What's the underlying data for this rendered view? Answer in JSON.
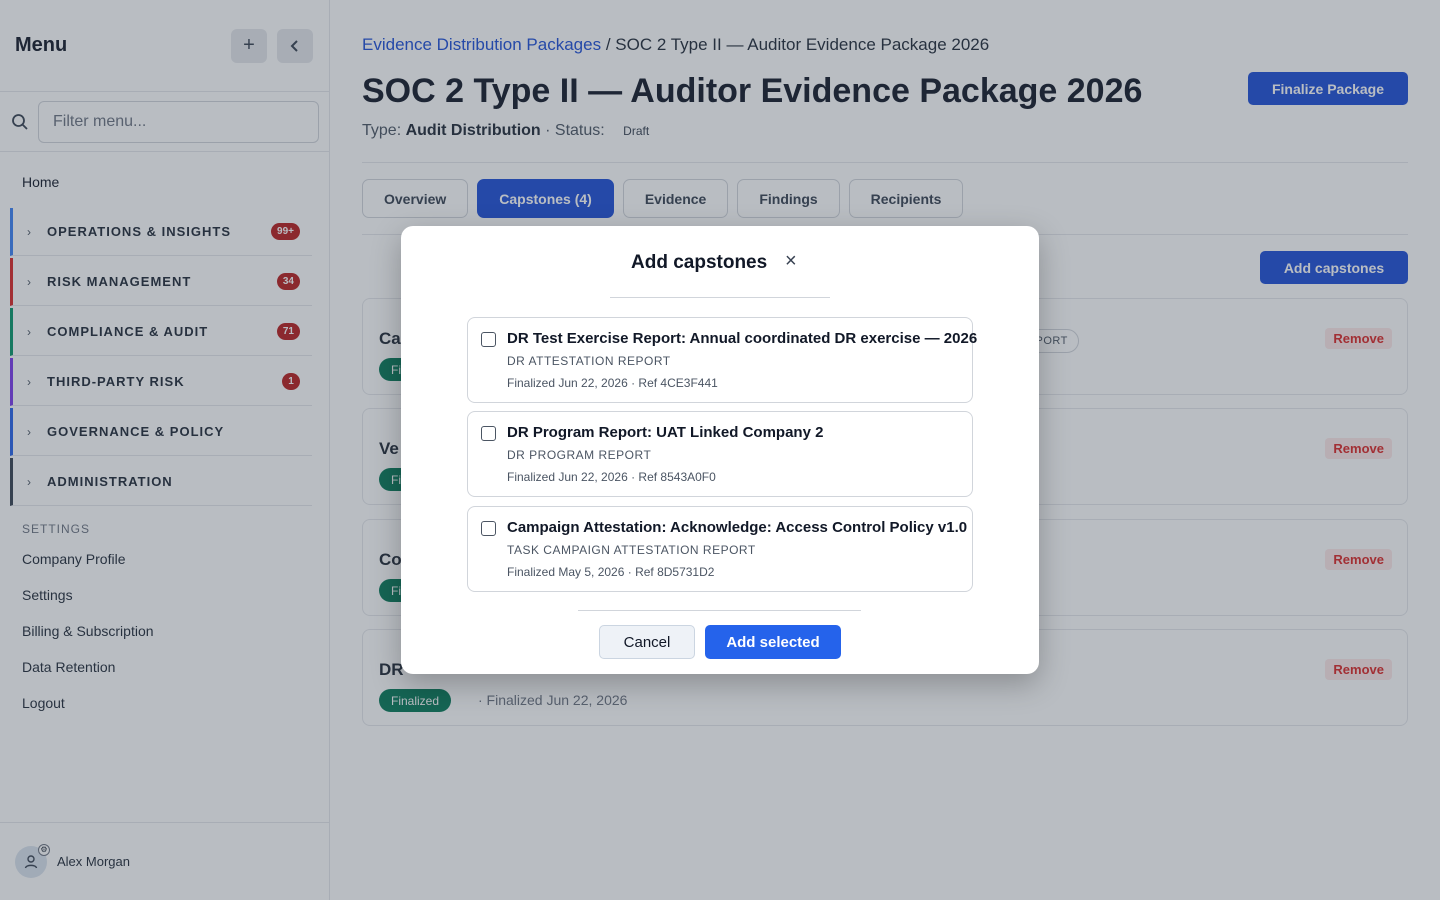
{
  "sidebar": {
    "title": "Menu",
    "add_icon": "plus-icon",
    "collapse_icon": "chevron-left-icon",
    "search_placeholder": "Filter menu...",
    "home": "Home",
    "groups": [
      {
        "label": "OPERATIONS & INSIGHTS",
        "badge": "99+",
        "color": "#3b82f6"
      },
      {
        "label": "RISK MANAGEMENT",
        "badge": "34",
        "color": "#dc2626"
      },
      {
        "label": "COMPLIANCE & AUDIT",
        "badge": "71",
        "color": "#059669"
      },
      {
        "label": "THIRD-PARTY RISK",
        "badge": "1",
        "color": "#7c3aed"
      },
      {
        "label": "GOVERNANCE & POLICY",
        "badge": "",
        "color": "#2563eb"
      },
      {
        "label": "ADMINISTRATION",
        "badge": "",
        "color": "#374151"
      }
    ],
    "settings_heading": "SETTINGS",
    "links": [
      "Company Profile",
      "Settings",
      "Billing & Subscription",
      "Data Retention",
      "Logout"
    ],
    "user": "Alex Morgan"
  },
  "main": {
    "breadcrumb_link": "Evidence Distribution Packages",
    "breadcrumb_sep": "/",
    "breadcrumb_current": "SOC 2 Type II — Auditor Evidence Package 2026",
    "title": "SOC 2 Type II — Auditor Evidence Package 2026",
    "type_label": "Type:",
    "type_value": "Audit Distribution",
    "status_label": "· Status:",
    "status_value": "Draft",
    "finalize_label": "Finalize Package",
    "tabs": [
      "Overview",
      "Capstones (4)",
      "Evidence",
      "Findings",
      "Recipients"
    ],
    "active_tab": 1,
    "add_capstones_label": "Add capstones",
    "cards": [
      {
        "title": "Ca",
        "chip": "Fi",
        "date": "",
        "type": "TATION REPORT",
        "remove": "Remove"
      },
      {
        "title": "Ve",
        "chip": "Fi",
        "date": "",
        "type": "",
        "remove": "Remove"
      },
      {
        "title": "Co",
        "chip": "Fi",
        "date": "",
        "type": "",
        "remove": "Remove"
      },
      {
        "title": "DR",
        "chip": "Finalized",
        "date": "· Finalized Jun 22, 2026",
        "type": "",
        "remove": "Remove"
      }
    ]
  },
  "modal": {
    "title": "Add capstones",
    "close": "×",
    "options": [
      {
        "title": "DR Test Exercise Report: Annual coordinated DR exercise — 2026",
        "type": "DR ATTESTATION REPORT",
        "meta": "Finalized Jun 22, 2026 · Ref 4CE3F441",
        "checked": false
      },
      {
        "title": "DR Program Report: UAT Linked Company 2",
        "type": "DR PROGRAM REPORT",
        "meta": "Finalized Jun 22, 2026 · Ref 8543A0F0",
        "checked": false
      },
      {
        "title": "Campaign Attestation: Acknowledge: Access Control Policy v1.0",
        "type": "TASK CAMPAIGN ATTESTATION REPORT",
        "meta": "Finalized May 5, 2026 · Ref 8D5731D2",
        "checked": false
      }
    ],
    "cancel_label": "Cancel",
    "add_selected_label": "Add selected"
  },
  "colors": {
    "primary": "#1d4ed8",
    "badge": "#b91c1c",
    "finalized": "#047857",
    "remove": "#dc2626"
  }
}
